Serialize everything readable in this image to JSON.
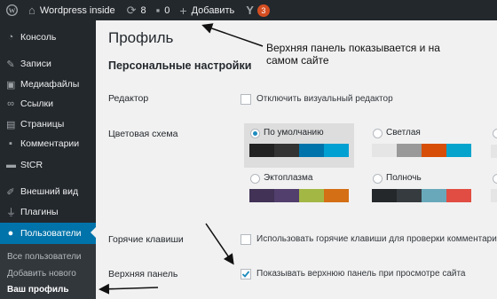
{
  "adminbar": {
    "site_name": "Wordpress inside",
    "updates_count": "8",
    "comments_count": "0",
    "add_label": "Добавить",
    "notif_count": "3"
  },
  "sidebar": {
    "items": [
      {
        "label": "Консоль",
        "icon": "dashboard-icon"
      },
      {
        "label": "Записи",
        "icon": "pin-icon"
      },
      {
        "label": "Медиафайлы",
        "icon": "media-icon"
      },
      {
        "label": "Ссылки",
        "icon": "link-icon"
      },
      {
        "label": "Страницы",
        "icon": "pages-icon"
      },
      {
        "label": "Комментарии",
        "icon": "comment-icon"
      },
      {
        "label": "StCR",
        "icon": "stcr-icon"
      },
      {
        "label": "Внешний вид",
        "icon": "brush-icon"
      },
      {
        "label": "Плагины",
        "icon": "plugin-icon"
      },
      {
        "label": "Пользователи",
        "icon": "users-icon"
      }
    ],
    "submenu": [
      "Все пользователи",
      "Добавить нового",
      "Ваш профиль"
    ]
  },
  "main": {
    "title": "Профиль",
    "section": "Персональные настройки",
    "editor_label": "Редактор",
    "editor_checkbox": "Отключить визуальный редактор",
    "color_label": "Цветовая схема",
    "schemes": [
      {
        "name": "По умолчанию",
        "selected": true,
        "colors": [
          "#222222",
          "#333333",
          "#0073aa",
          "#00a0d2"
        ]
      },
      {
        "name": "Светлая",
        "selected": false,
        "colors": [
          "#e5e5e5",
          "#999999",
          "#d64e07",
          "#04a4cc"
        ]
      },
      {
        "name": "Эктоплазма",
        "selected": false,
        "colors": [
          "#413256",
          "#523f6d",
          "#a3b745",
          "#d46f15"
        ]
      },
      {
        "name": "Полночь",
        "selected": false,
        "colors": [
          "#25282b",
          "#363b3f",
          "#69a8bb",
          "#e14d43"
        ]
      }
    ],
    "hotkeys_label": "Горячие клавиши",
    "hotkeys_checkbox": "Использовать горячие клавиши для проверки комментариев.",
    "toolbar_label": "Верхняя панель",
    "toolbar_checkbox": "Показывать верхнюю панель при просмотре сайта"
  },
  "annotation": {
    "line1": "Верхняя панель показывается и на",
    "line2": "самом сайте"
  },
  "colors": {
    "accent": "#0073aa",
    "sidebar": "#23282d",
    "badge": "#d54e21"
  }
}
